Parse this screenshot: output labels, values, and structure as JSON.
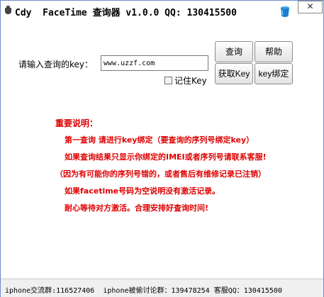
{
  "window": {
    "title": "Cdy  FaceTime 查询器 v1.0.0 QQ: 130415500",
    "close_label": "✕"
  },
  "form": {
    "key_label": "请输入查询的key：",
    "key_value": "www.uzzf.com",
    "remember_label": "记住Key"
  },
  "buttons": {
    "query": "查询",
    "help": "帮助",
    "get_key": "获取Key",
    "bind_key": "key绑定"
  },
  "notes": {
    "title": "重要说明：",
    "lines": [
      "第一查询 请进行key绑定（要查询的序列号绑定key）",
      "如果查询结果只显示你绑定的IMEI或者序列号请联系客服!",
      "（因为有可能你的序列号错的，或者售后有维修记录已注销）",
      "如果facetime号码为空说明没有激活记录。",
      "耐心等待对方激活。合理安排好查询时间!"
    ]
  },
  "status": {
    "text": "iphone交流群:116527406  iphone被偷讨论群：139478254 客服QQ：130415500"
  },
  "colors": {
    "note_text": "#e00000",
    "window_border": "#6d8fc9"
  },
  "icons": [
    "app-icon",
    "bucket-icon",
    "close-icon",
    "checkbox"
  ]
}
